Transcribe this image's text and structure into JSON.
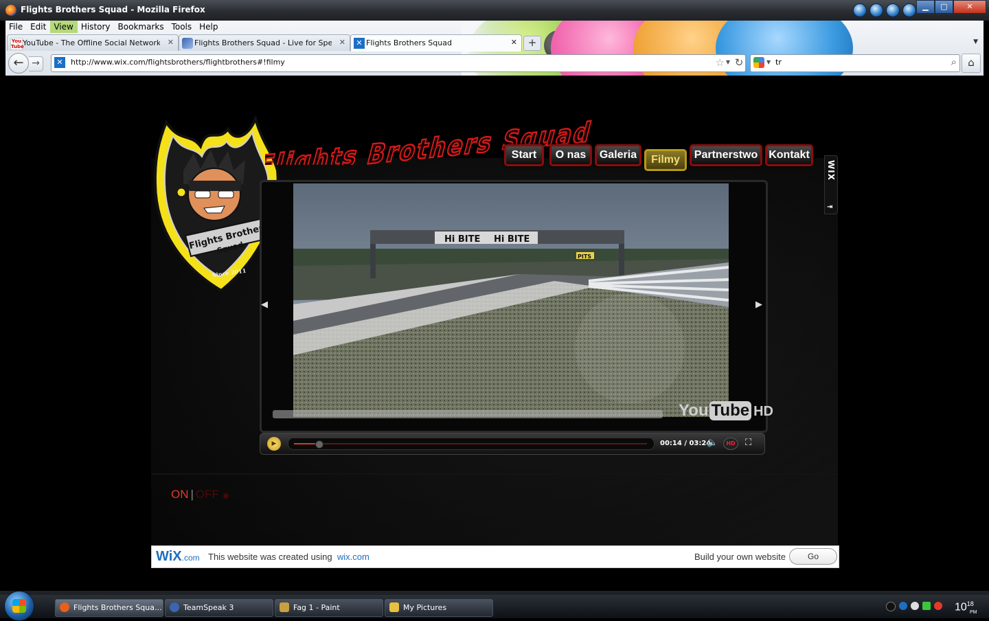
{
  "window": {
    "title": "Flights Brothers Squad - Mozilla Firefox"
  },
  "menubar": {
    "items": [
      "File",
      "Edit",
      "View",
      "History",
      "Bookmarks",
      "Tools",
      "Help"
    ]
  },
  "tabs": [
    {
      "label": "YouTube - The Offline Social Network (H...",
      "icon": "youtube-icon"
    },
    {
      "label": "Flights Brothers Squad - Live for Speed",
      "icon": "lfs-icon"
    },
    {
      "label": "Flights Brothers Squad",
      "icon": "wix-icon",
      "active": true
    }
  ],
  "navbar": {
    "url": "http://www.wix.com/flightsbrothers/flightbrothers#!filmy",
    "search_value": "tr"
  },
  "page": {
    "logo": {
      "badge_text_line1": "Flights Brothers",
      "badge_text_line2": "Squad",
      "since": "Since 2011"
    },
    "brand_title": "Flights Brothers Squad",
    "nav": [
      {
        "label": "Start"
      },
      {
        "label": "O nas"
      },
      {
        "label": "Galeria"
      },
      {
        "label": "Filmy",
        "active": true
      },
      {
        "label": "Partnerstwo"
      },
      {
        "label": "Kontakt"
      }
    ],
    "wix_tab": "WIX",
    "video": {
      "billboard_left": "Hi BITE",
      "billboard_right": "Hi BITE",
      "pits_sign": "PITS",
      "youtube_you": "You",
      "youtube_tube": "Tube",
      "youtube_hd": "HD",
      "time": "00:14 / 03:24",
      "hd_button": "HD",
      "progress_fraction": 0.07
    },
    "music": {
      "on": "ON",
      "separator": "|",
      "off": "OFF"
    },
    "wix_banner": {
      "logo_wix": "WiX",
      "logo_com": ".com",
      "message": "This website was created using",
      "link": "wix.com",
      "build": "Build your own website",
      "go": "Go"
    }
  },
  "taskbar": {
    "items": [
      {
        "label": "Flights Brothers Squa...",
        "active": true,
        "color": "#e8601a"
      },
      {
        "label": "TeamSpeak 3",
        "color": "#3a66b0"
      },
      {
        "label": "Fag 1 - Paint",
        "color": "#c8a040"
      },
      {
        "label": "My Pictures",
        "color": "#e8c040"
      }
    ],
    "clock_hour": "10",
    "clock_min": "18",
    "clock_ampm": "PM"
  },
  "colors": {
    "accent_red": "#8a0d0d",
    "active_gold": "#b89a18",
    "wix_blue": "#1d6fbf"
  }
}
